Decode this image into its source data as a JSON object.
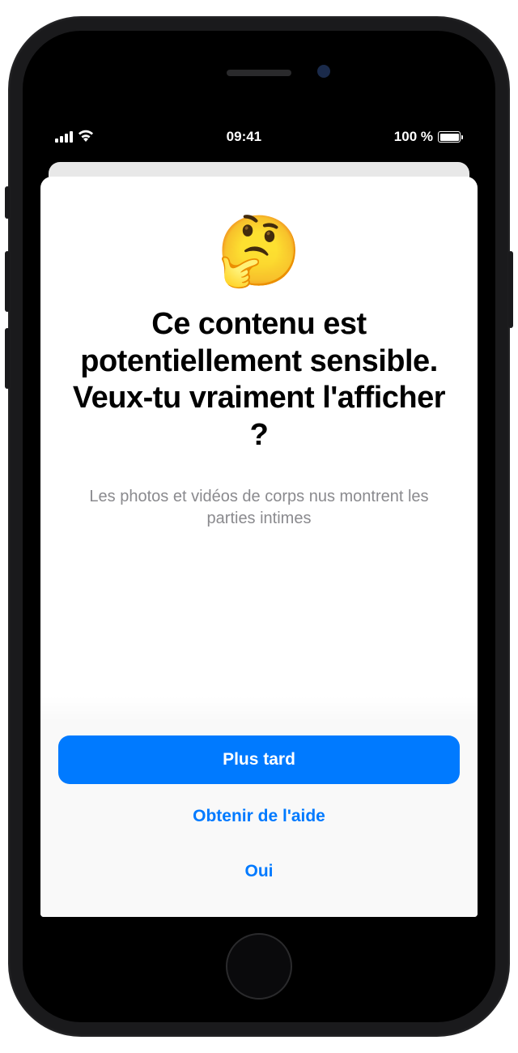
{
  "status": {
    "time": "09:41",
    "battery": "100 %"
  },
  "modal": {
    "emoji": "🤔",
    "title_line1": "Ce contenu est potentiellement sensible.",
    "title_line2": "Veux-tu vraiment l'afficher ?",
    "subtitle": "Les photos et vidéos de corps nus montrent les parties intimes"
  },
  "buttons": {
    "later": "Plus tard",
    "help": "Obtenir de l'aide",
    "yes": "Oui"
  }
}
